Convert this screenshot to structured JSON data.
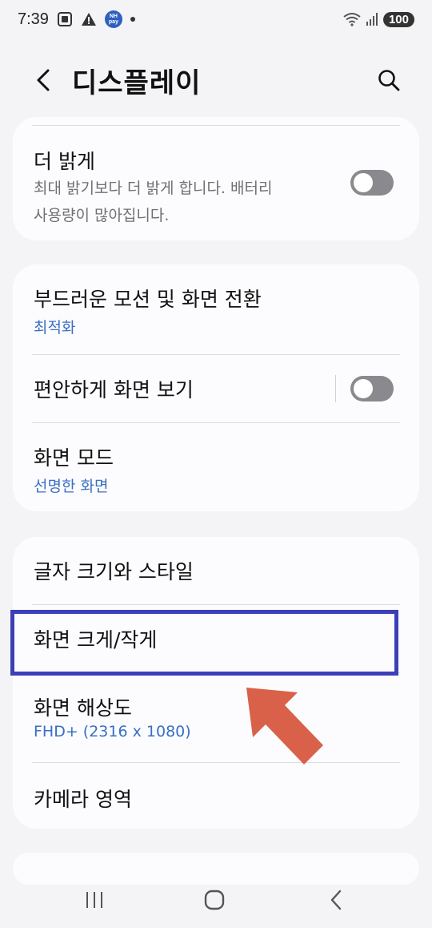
{
  "status_bar": {
    "time": "7:39",
    "nh_top": "NH",
    "nh_bottom": "pay",
    "battery": "100"
  },
  "header": {
    "title": "디스플레이",
    "back_icon": "chevron-left-icon",
    "search_icon": "search-icon"
  },
  "sections": {
    "extra_brightness": {
      "title": "더 밝게",
      "description_line1": "최대 밝기보다 더 밝게 합니다. 배터리",
      "description_line2": "사용량이 많아집니다.",
      "enabled": false
    },
    "motion": {
      "title": "부드러운 모션 및 화면 전환",
      "value": "최적화"
    },
    "comfort_view": {
      "title": "편안하게 화면 보기",
      "enabled": false
    },
    "screen_mode": {
      "title": "화면 모드",
      "value": "선명한 화면"
    },
    "font_style": {
      "title": "글자 크기와 스타일"
    },
    "screen_zoom": {
      "title": "화면 크게/작게"
    },
    "resolution": {
      "title": "화면 해상도",
      "value": "FHD+ (2316 x 1080)"
    },
    "camera_cutout": {
      "title": "카메라 영역"
    }
  },
  "annotation": {
    "highlight_color": "#3b3fb8",
    "arrow_color": "#d9614a"
  },
  "colors": {
    "accent_blue": "#3a6fc4",
    "toggle_off": "#8a8a8e",
    "background": "#f4f4f6"
  },
  "nav_bar": {
    "recents_icon": "recents-icon",
    "home_icon": "home-icon",
    "back_icon": "back-icon"
  }
}
